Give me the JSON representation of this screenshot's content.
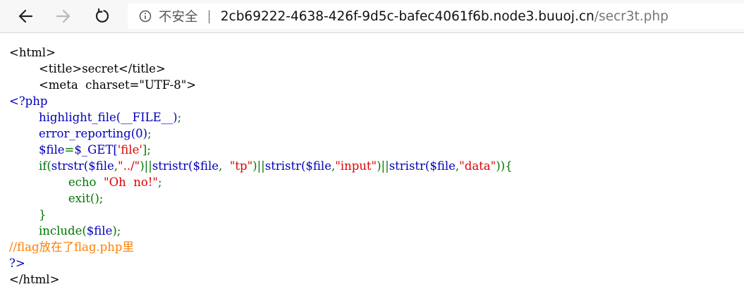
{
  "browser": {
    "security_label": "不安全",
    "separator": "|",
    "url_host": "2cb69222-4638-426f-9d5c-bafec4061f6b.node3.buuoj.cn",
    "url_path": "/secr3t.php",
    "icons": [
      "back-arrow-icon",
      "forward-arrow-icon",
      "refresh-icon",
      "info-icon"
    ]
  },
  "code": {
    "l1": "<html>",
    "l2": "        <title>secret</title>",
    "l3": "        <meta  charset=\"UTF-8\">",
    "l4": "<?php",
    "l5_indent": "        ",
    "l5a": "highlight_file(__FILE__)",
    "l5b": ";",
    "l6a": "error_reporting(0)",
    "l6b": ";",
    "l7a": "$file",
    "l7b": "=",
    "l7c": "$_GET[",
    "l7d": "'file'",
    "l7e": "];",
    "l8a": "if(",
    "l8b": "strstr(",
    "l8c": "$file",
    "l8d": ",",
    "l8e": "\"../\"",
    "l8f": ")||",
    "l8g": "stristr(",
    "l8h": "$file",
    "l8i": ",  ",
    "l8j": "\"tp\"",
    "l8k": ")||",
    "l8l": "stristr(",
    "l8m": "$file",
    "l8n": ",",
    "l8o": "\"input\"",
    "l8p": ")||",
    "l8q": "stristr(",
    "l8r": "$file",
    "l8s": ",",
    "l8t": "\"data\"",
    "l8u": ")){",
    "l9_indent": "                ",
    "l9a": "echo  ",
    "l9b": "\"Oh  no!\"",
    "l9c": ";",
    "l10a": "exit()",
    "l10b": ";",
    "l11": "}",
    "l12a": "include(",
    "l12b": "$file",
    "l12c": ");",
    "l13": "//flag放在了flag.php里",
    "l14": "?>",
    "l15": "</html>"
  },
  "colors": {
    "html": "#000000",
    "default": "#0000bb",
    "keyword": "#007700",
    "string": "#dd0000",
    "comment": "#ff8000"
  }
}
